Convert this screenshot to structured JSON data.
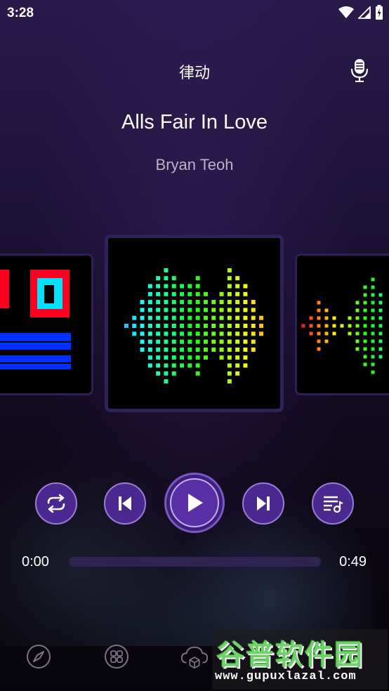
{
  "status_bar": {
    "time": "3:28"
  },
  "header": {
    "title": "律动"
  },
  "song": {
    "title": "Alls Fair In Love",
    "artist": "Bryan Teoh"
  },
  "player": {
    "current_time": "0:00",
    "total_time": "0:49",
    "progress": 0
  },
  "icons": {
    "repeat": "repeat-icon",
    "previous": "skip-previous-icon",
    "play": "play-icon",
    "next": "skip-next-icon",
    "playlist": "playlist-music-icon",
    "mic": "microphone-icon",
    "nav": [
      "compass-icon",
      "grid-icon",
      "cloud-box-icon"
    ]
  },
  "watermark": {
    "brand": "谷普软件园",
    "url": "www.gupuxlazal.com"
  },
  "colors": {
    "accent": "#4b2790",
    "accent_border": "#9a7cd6",
    "background": "#140b25"
  }
}
